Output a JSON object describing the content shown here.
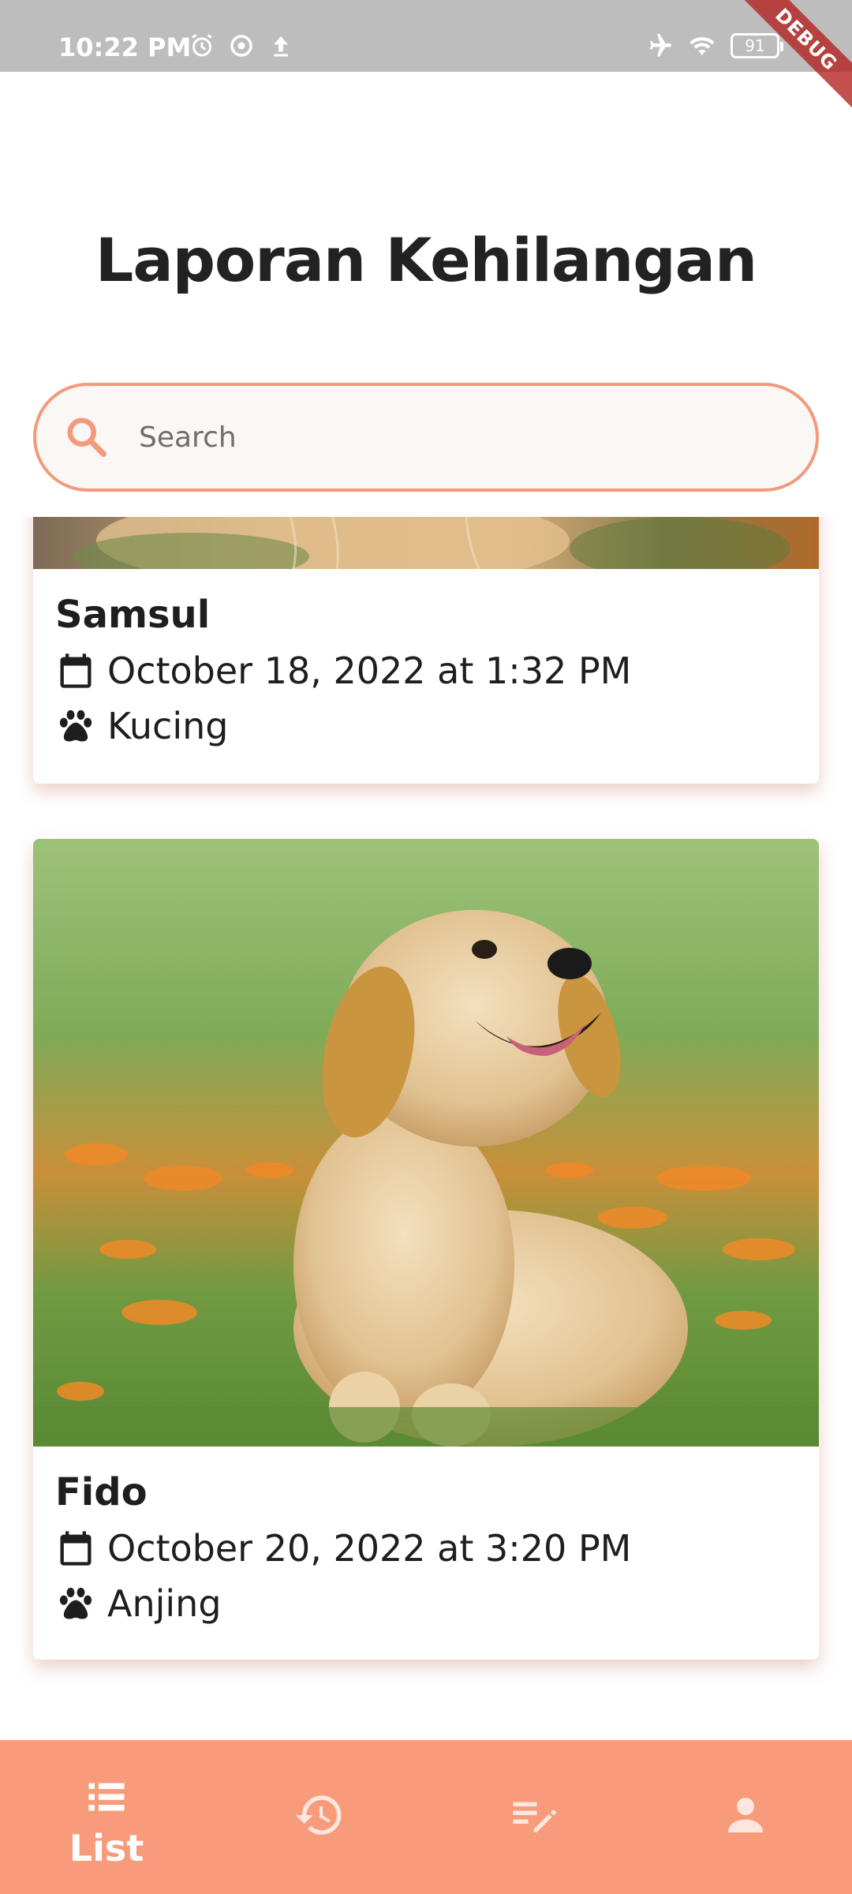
{
  "status_bar": {
    "time": "10:22 PM",
    "battery": "91",
    "debug_label": "DEBUG"
  },
  "page": {
    "title": "Laporan Kehilangan"
  },
  "search": {
    "placeholder": "Search"
  },
  "reports": [
    {
      "name": "Samsul",
      "datetime": "October 18, 2022 at 1:32 PM",
      "animal_type": "Kucing"
    },
    {
      "name": "Fido",
      "datetime": "October 20, 2022 at 3:20 PM",
      "animal_type": "Anjing"
    }
  ],
  "bottom_nav": {
    "items": [
      {
        "label": "List",
        "icon": "list-icon",
        "active": true
      },
      {
        "label": "",
        "icon": "history-icon",
        "active": false
      },
      {
        "label": "",
        "icon": "edit-note-icon",
        "active": false
      },
      {
        "label": "",
        "icon": "person-icon",
        "active": false
      }
    ]
  },
  "colors": {
    "accent": "#f89b7b",
    "search_border": "#f39a7c",
    "status_bar": "#bdbdbd"
  }
}
